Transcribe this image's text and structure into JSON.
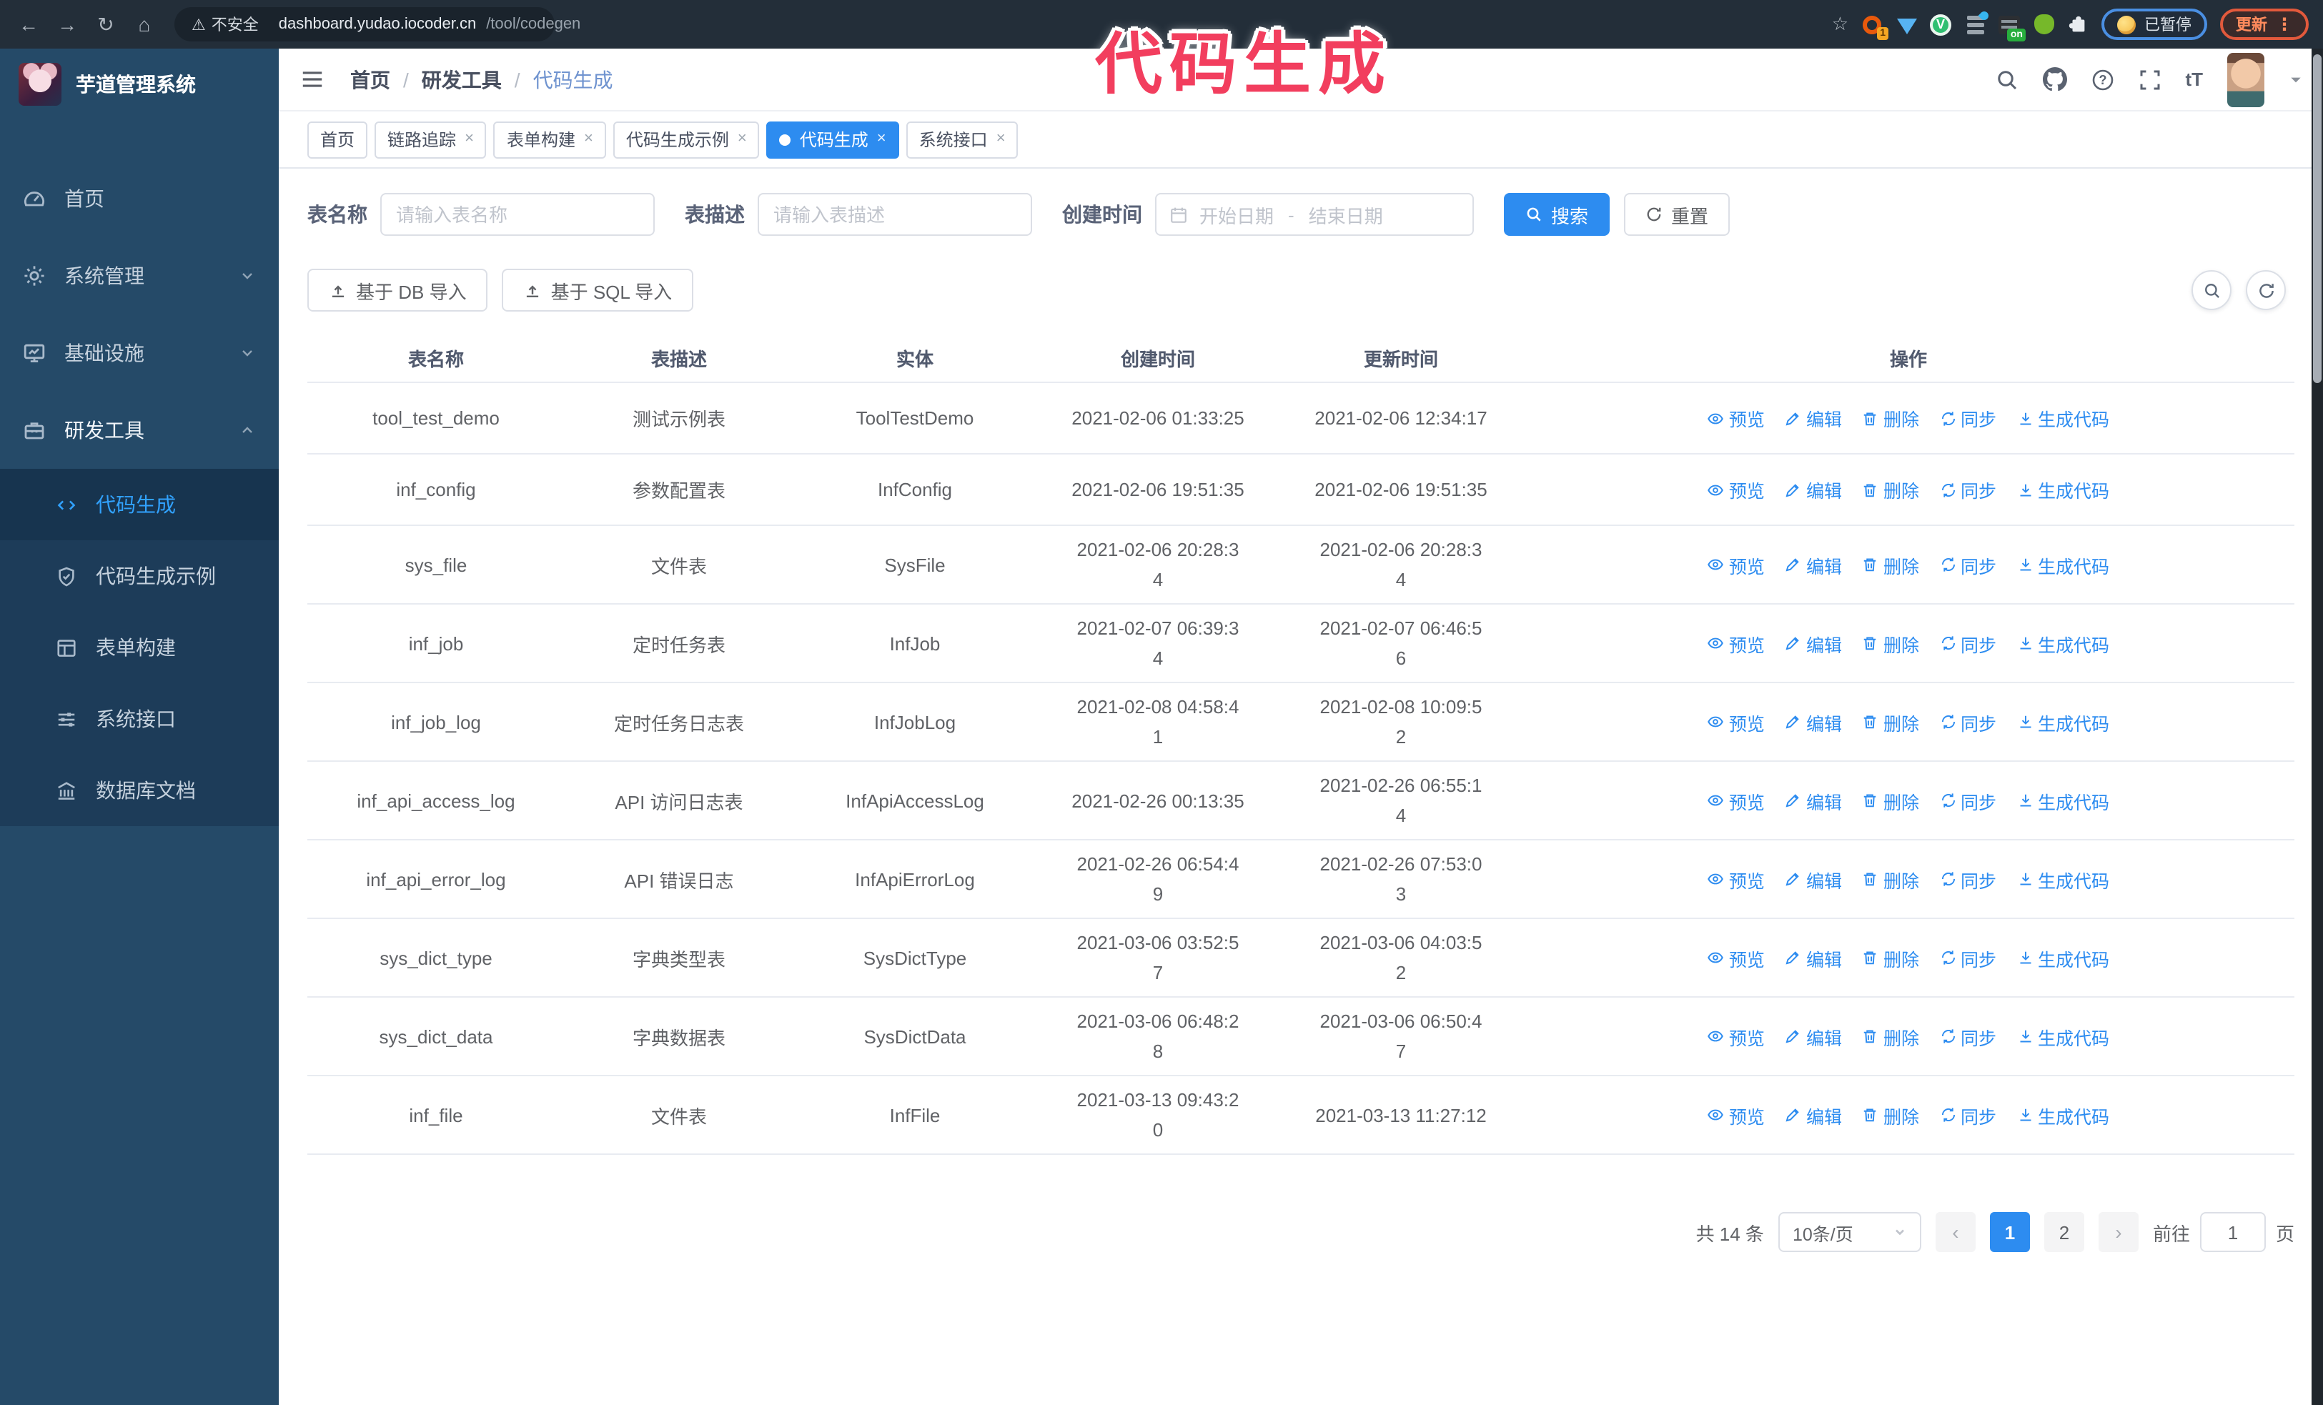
{
  "annotation": {
    "text": "代码生成",
    "color": "#f23e5e"
  },
  "browser": {
    "security_label": "不安全",
    "url_host": "dashboard.yudao.iocoder.cn",
    "url_path": "/tool/codegen",
    "ext_badge": "1",
    "ext_on_badge": "on",
    "paused_badge": "已暂停",
    "update_button": "更新"
  },
  "sidebar": {
    "app_title": "芋道管理系统",
    "items": [
      {
        "label": "首页"
      },
      {
        "label": "系统管理"
      },
      {
        "label": "基础设施"
      },
      {
        "label": "研发工具"
      }
    ],
    "submenu": [
      {
        "label": "代码生成",
        "active": true
      },
      {
        "label": "代码生成示例"
      },
      {
        "label": "表单构建"
      },
      {
        "label": "系统接口"
      },
      {
        "label": "数据库文档"
      }
    ]
  },
  "breadcrumb": {
    "home": "首页",
    "group": "研发工具",
    "current": "代码生成"
  },
  "tags": [
    {
      "label": "首页",
      "closable": false,
      "active": false
    },
    {
      "label": "链路追踪",
      "closable": true,
      "active": false
    },
    {
      "label": "表单构建",
      "closable": true,
      "active": false
    },
    {
      "label": "代码生成示例",
      "closable": true,
      "active": false
    },
    {
      "label": "代码生成",
      "closable": true,
      "active": true
    },
    {
      "label": "系统接口",
      "closable": true,
      "active": false
    }
  ],
  "search_form": {
    "table_name_label": "表名称",
    "table_name_placeholder": "请输入表名称",
    "table_desc_label": "表描述",
    "table_desc_placeholder": "请输入表描述",
    "create_time_label": "创建时间",
    "start_placeholder": "开始日期",
    "range_separator": "-",
    "end_placeholder": "结束日期",
    "search_button": "搜索",
    "reset_button": "重置"
  },
  "toolbar": {
    "import_db_button": "基于 DB 导入",
    "import_sql_button": "基于 SQL 导入"
  },
  "table": {
    "columns": [
      "表名称",
      "表描述",
      "实体",
      "创建时间",
      "更新时间",
      "操作"
    ],
    "row_actions": [
      "预览",
      "编辑",
      "删除",
      "同步",
      "生成代码"
    ],
    "rows": [
      {
        "name": "tool_test_demo",
        "desc": "测试示例表",
        "entity": "ToolTestDemo",
        "created": "2021-02-06 01:33:25",
        "updated": "2021-02-06 12:34:17"
      },
      {
        "name": "inf_config",
        "desc": "参数配置表",
        "entity": "InfConfig",
        "created": "2021-02-06 19:51:35",
        "updated": "2021-02-06 19:51:35"
      },
      {
        "name": "sys_file",
        "desc": "文件表",
        "entity": "SysFile",
        "created": "2021-02-06 20:28:3\n4",
        "updated": "2021-02-06 20:28:3\n4"
      },
      {
        "name": "inf_job",
        "desc": "定时任务表",
        "entity": "InfJob",
        "created": "2021-02-07 06:39:3\n4",
        "updated": "2021-02-07 06:46:5\n6"
      },
      {
        "name": "inf_job_log",
        "desc": "定时任务日志表",
        "entity": "InfJobLog",
        "created": "2021-02-08 04:58:4\n1",
        "updated": "2021-02-08 10:09:5\n2"
      },
      {
        "name": "inf_api_access_log",
        "desc": "API 访问日志表",
        "entity": "InfApiAccessLog",
        "created": "2021-02-26 00:13:35",
        "updated": "2021-02-26 06:55:1\n4"
      },
      {
        "name": "inf_api_error_log",
        "desc": "API 错误日志",
        "entity": "InfApiErrorLog",
        "created": "2021-02-26 06:54:4\n9",
        "updated": "2021-02-26 07:53:0\n3"
      },
      {
        "name": "sys_dict_type",
        "desc": "字典类型表",
        "entity": "SysDictType",
        "created": "2021-03-06 03:52:5\n7",
        "updated": "2021-03-06 04:03:5\n2"
      },
      {
        "name": "sys_dict_data",
        "desc": "字典数据表",
        "entity": "SysDictData",
        "created": "2021-03-06 06:48:2\n8",
        "updated": "2021-03-06 06:50:4\n7"
      },
      {
        "name": "inf_file",
        "desc": "文件表",
        "entity": "InfFile",
        "created": "2021-03-13 09:43:2\n0",
        "updated": "2021-03-13 11:27:12"
      }
    ]
  },
  "pagination": {
    "total_text": "共 14 条",
    "page_size": "10条/页",
    "pages": [
      "1",
      "2"
    ],
    "active_page": "1",
    "goto_label": "前往",
    "goto_value": "1",
    "goto_suffix": "页"
  },
  "colors": {
    "accent": "#2d8cf0",
    "sidebar_bg": "#254a68",
    "submenu_bg": "#1d3c59",
    "annotation": "#f23e5e"
  }
}
